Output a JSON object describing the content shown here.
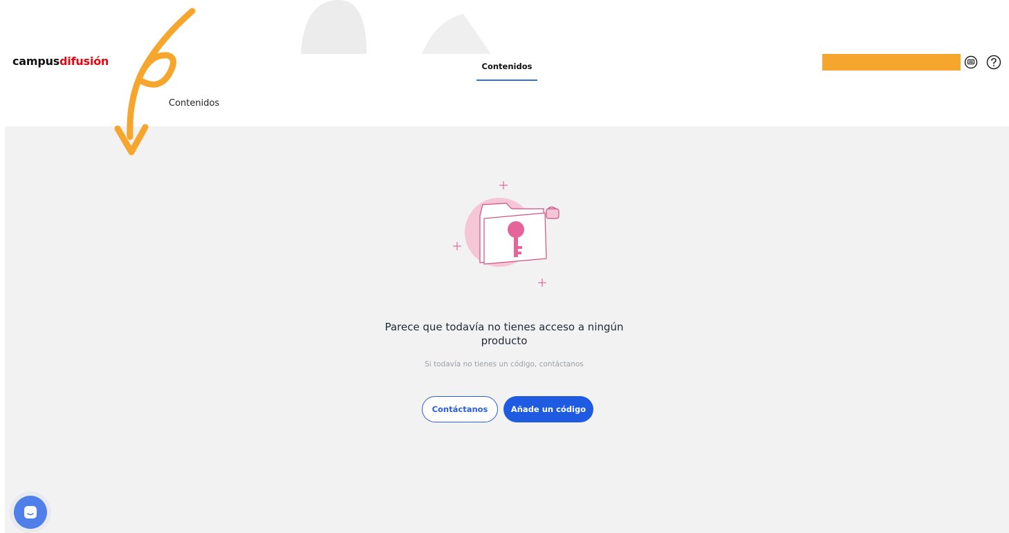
{
  "brand": {
    "part1": "campus",
    "part2": "difusión"
  },
  "header": {
    "nav_tab": "Contenidos",
    "subtitle": "Contenidos",
    "icons": [
      "chat-bubble-icon",
      "help-circle-icon"
    ]
  },
  "empty_state": {
    "title": "Parece que todavía no tienes acceso a ningún producto",
    "subtitle": "Si todavía no tienes un código, contáctanos",
    "illustration": "locked-folder-key-icon"
  },
  "buttons": {
    "contact": "Contáctanos",
    "add_code": "Añade un código"
  },
  "colors": {
    "brand_red": "#e30613",
    "primary_blue": "#1f5be0",
    "annotation_orange": "#f6a62c",
    "background": "#f2f2f2",
    "accent_pink": "#e5659a"
  },
  "widgets": {
    "chat_launcher": "chat-launcher-icon"
  }
}
